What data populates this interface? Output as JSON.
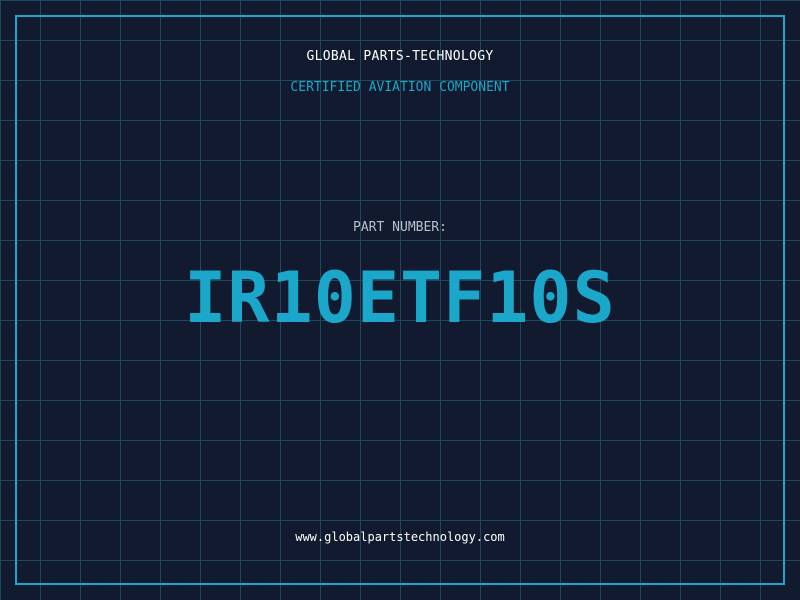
{
  "header": {
    "company": "GLOBAL PARTS-TECHNOLOGY",
    "subtitle": "CERTIFIED AVIATION COMPONENT"
  },
  "part": {
    "label": "PART NUMBER:",
    "number": "IR10ETF10S"
  },
  "footer": {
    "website": "www.globalpartstechnology.com"
  },
  "colors": {
    "background": "#111a2e",
    "grid": "#1e4a5f",
    "accent": "#1aa7c9",
    "text": "#ffffff",
    "muted": "#b8c0cc"
  }
}
